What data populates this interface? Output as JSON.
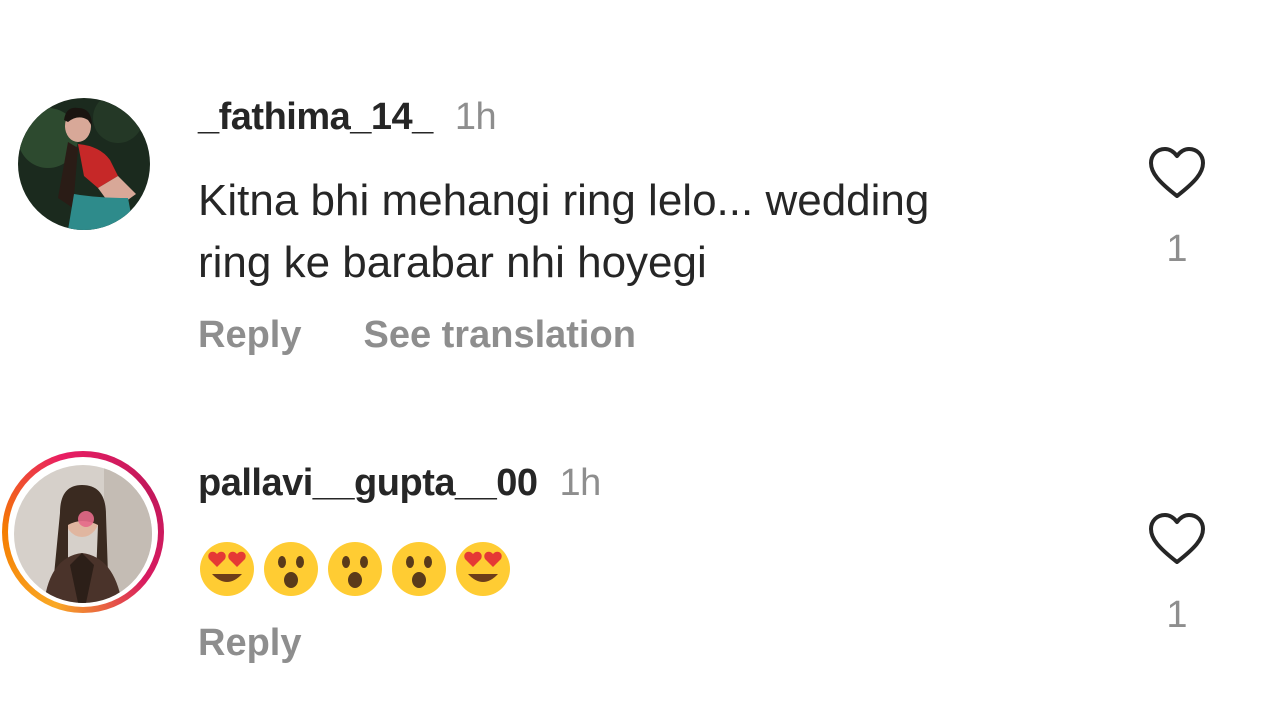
{
  "comments": [
    {
      "username": "_fathima_14_",
      "time": "1h",
      "text_line1": "Kitna bhi mehangi ring lelo... wedding",
      "text_line2": "ring ke barabar nhi hoyegi",
      "reply_label": "Reply",
      "translate_label": "See translation",
      "like_icon": "heart-outline-icon",
      "likes": "1"
    },
    {
      "username": "pallavi__gupta__00",
      "time": "1h",
      "emojis": [
        "heart-eyes-emoji",
        "surprised-emoji",
        "surprised-emoji",
        "surprised-emoji",
        "heart-eyes-emoji"
      ],
      "has_story_ring": true,
      "reply_label": "Reply",
      "like_icon": "heart-outline-icon",
      "likes": "1"
    }
  ],
  "colors": {
    "text": "#262626",
    "secondary": "#8e8e8e",
    "background": "#ffffff"
  }
}
